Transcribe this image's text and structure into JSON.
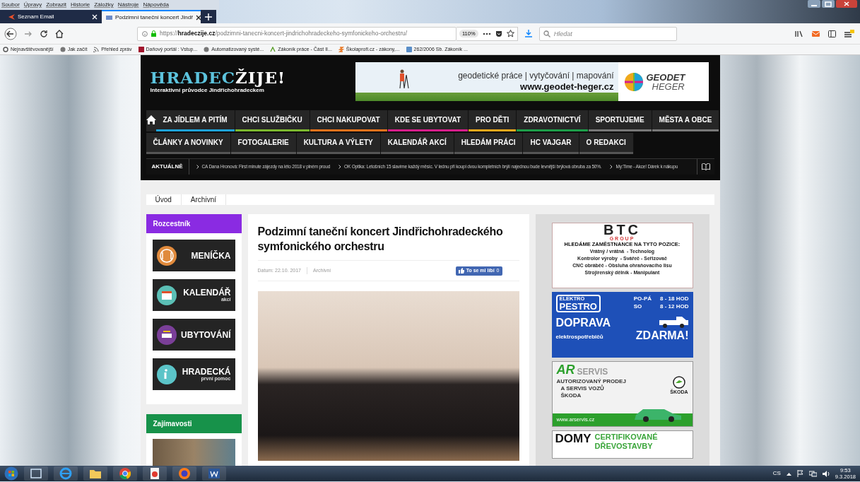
{
  "menu": [
    "Soubor",
    "Úpravy",
    "Zobrazit",
    "Historie",
    "Záložky",
    "Nástroje",
    "Nápověda"
  ],
  "tabs": [
    {
      "title": "Seznam Email",
      "selected": false
    },
    {
      "title": "Podzimní taneční koncert Jindř",
      "selected": true
    }
  ],
  "address": {
    "url": "https://**hradeczije.cz**/podzimni-tanecni-koncert-jindrichohradeckeho-symfonickeho-orchestru/",
    "zoom": "110%"
  },
  "search": {
    "placeholder": "Hledat"
  },
  "bookmarks": [
    "Nejnavštěvovanější",
    "Jak začít",
    "Přehled zpráv",
    "Daňový portál : Vstup...",
    "Automatizovaný systé...",
    "Zákoník práce - Část II...",
    "Školaprofi.cz - zákony,...",
    "262/2006 Sb. Zákoník ..."
  ],
  "logo": {
    "name": "HRADEC",
    "accent": "ŽIJE!",
    "tagline": "Interaktivní průvodce Jindřichohradeckem"
  },
  "banner": {
    "text": "geodetické práce | vytyčování | mapování",
    "url": "www.geodet-heger.cz",
    "brand_top": "GEODET",
    "brand_bottom": "HEGER"
  },
  "nav_rows": [
    [
      {
        "label": "ZA JÍDLEM A PITÍM",
        "color": "#1fa3d8"
      },
      {
        "label": "CHCI SLUŽBIČKU",
        "color": "#7cb82f"
      },
      {
        "label": "CHCI NAKUPOVAT",
        "color": "#e8731c"
      },
      {
        "label": "KDE SE UBYTOVAT",
        "color": "#d61f8c"
      },
      {
        "label": "PRO DĚTI",
        "color": "#f0a91c"
      },
      {
        "label": "ZDRAVOTNICTVÍ",
        "color": "#1e9e4a"
      },
      {
        "label": "SPORTUJEME",
        "color": "#777777"
      },
      {
        "label": "MĚSTA A OBCE",
        "color": "#777777"
      }
    ],
    [
      {
        "label": "ČLÁNKY A NOVINKY",
        "color": "#555555"
      },
      {
        "label": "FOTOGALERIE",
        "color": "#555555"
      },
      {
        "label": "KULTURA A VÝLETY",
        "color": "#555555"
      },
      {
        "label": "KALENDÁŘ AKCÍ",
        "color": "#555555"
      },
      {
        "label": "HLEDÁM PRÁCI",
        "color": "#555555"
      },
      {
        "label": "HC VAJGAR",
        "color": "#555555"
      },
      {
        "label": "O REDAKCI",
        "color": "#555555"
      }
    ]
  ],
  "ticker": {
    "label": "AKTUÁLNĚ",
    "items": [
      "CA Dana Hronová: First minute zájezdy na léto 2018 v plném proud",
      "OK Optika: Letošních 15 slavíme každý měsíc. V lednu při koupi dvou kompletních brýlí najednou bude levnější brýlová obruba za 50%.",
      "My:Time - Akce! Dárek k nákupu"
    ]
  },
  "breadcrumb": [
    "Úvod",
    "Archivní"
  ],
  "sidebar": {
    "title": "Rozcestník",
    "tiles": [
      {
        "label": "MENÍČKA",
        "color": "#e08a3c"
      },
      {
        "label": "KALENDÁŘ",
        "sub": "akcí",
        "color": "#5bbfb5"
      },
      {
        "label": "UBYTOVÁNÍ",
        "color": "#7a3f98"
      },
      {
        "label": "HRADECKÁ",
        "sub": "první pomoc",
        "color": "#5bc4c8"
      }
    ],
    "section": "Zajímavosti"
  },
  "article": {
    "title": "Podzimní taneční koncert Jindřichohradeckého symfonického orchestru",
    "date": "Datum: 22.10. 2017",
    "category": "Archivní",
    "like": "To se mi líbí",
    "likes": "0"
  },
  "ads": {
    "btc": {
      "logo": "BTC",
      "group": "GROUP",
      "heading": "HLEDÁME ZAMĚSTNANCE NA TYTO POZICE:",
      "lines": [
        "Vrátný / vrátná  - Technolog",
        "Kontrolor výroby  - Svářeč - Seřizovač",
        "CNC obráběč - Obsluha ohraňovacího lisu",
        "Strojirenský dělník - Manipulant"
      ]
    },
    "pestro": {
      "brand_top": "ELEKTRO",
      "brand": "PESTRO",
      "hours": [
        [
          "PO-PÁ",
          "8 - 18 HOD"
        ],
        [
          "SO",
          "8 - 12 HOD"
        ]
      ],
      "headline": "DOPRAVA",
      "sub": "elektrospotřebičů",
      "free": "ZDARMA!"
    },
    "ar": {
      "brand": "AR",
      "brand_rest": "SERVIS",
      "lines": [
        "AUTORIZOVANÝ PRODEJ",
        "A SERVIS VOZŮ",
        "ŠKODA"
      ],
      "badge": "ŠKODA",
      "url": "www.arservis.cz"
    },
    "domy": {
      "brand": "DOMY",
      "lines": [
        "CERTIFIKOVANÉ",
        "DŘEVOSTAVBY"
      ]
    }
  },
  "taskbar": {
    "lang": "CS",
    "time": "9:53",
    "date": "9.3.2018"
  }
}
